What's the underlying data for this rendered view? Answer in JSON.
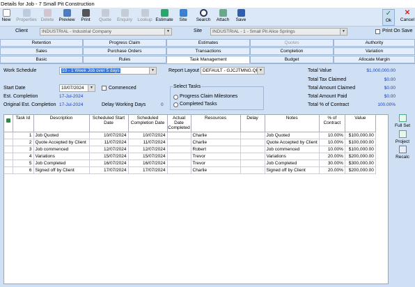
{
  "window": {
    "title": "Details for Job - 7  Small Pit Construction"
  },
  "toolbar": {
    "new": "New",
    "properties": "Properties",
    "delete": "Delete",
    "preview": "Preview",
    "print": "Print",
    "quote": "Quote",
    "enquiry": "Enquiry",
    "lookup": "Lookup",
    "estimate": "Estimate",
    "site": "Site",
    "search": "Search",
    "attach": "Attach",
    "save": "Save",
    "ok": "Ok",
    "cancel": "Cancel"
  },
  "client": {
    "label": "Client",
    "value": "INDUSTRIAL - Industrial Company"
  },
  "site": {
    "label": "Site",
    "value": "INDUSTRIAL - 1 - Small Pit Alice Springs"
  },
  "print_on_save": "Print On Save",
  "tabs": {
    "row1": [
      "Retention",
      "Progress Claim",
      "Estimates",
      "Quotes",
      "Authority"
    ],
    "row2": [
      "Sales",
      "Purchase Orders",
      "Transactions",
      "Completion",
      "Variation"
    ],
    "row3": [
      "Basic",
      "Rules",
      "Task Management",
      "Budget",
      "Allocate Margin"
    ]
  },
  "work_schedule": {
    "label": "Work Schedule",
    "value": "10 - 1 Week Job over 5 days"
  },
  "report_layout": {
    "label": "Report Layout",
    "value": "DEFAULT - GJCJTMNG.QR"
  },
  "start_date": {
    "label": "Start Date",
    "value": "10/07/2024"
  },
  "commenced": "Commenced",
  "est_completion": {
    "label": "Est. Completion",
    "value": "17-Jul-2024"
  },
  "orig_est_completion": {
    "label": "Original Est. Completion",
    "value": "17-Jul-2024"
  },
  "delay_working_days": {
    "label": "Delay Working Days",
    "value": "0"
  },
  "select_tasks": {
    "label": "Select Tasks",
    "opt1": "Progress Claim Milestones",
    "opt2": "Completed Tasks"
  },
  "totals": {
    "total_value": {
      "label": "Total Value",
      "value": "$1,000,000.00"
    },
    "total_tax_claimed": {
      "label": "Total Tax Claimed",
      "value": "$0.00"
    },
    "total_amount_claimed": {
      "label": "Total Amount Claimed",
      "value": "$0.00"
    },
    "total_amount_paid": {
      "label": "Total Amount Paid",
      "value": "$0.00"
    },
    "total_pct_contract": {
      "label": "Total % of Contract",
      "value": "100.00%"
    }
  },
  "grid": {
    "headers": [
      "Task Id",
      "Description",
      "Scheduled Start Date",
      "Scheduled Completion Date",
      "Actual Date Completed",
      "Resources",
      "Delay",
      "Notes",
      "% of Contract",
      "Value"
    ],
    "rows": [
      [
        "1",
        "Job Quoted",
        "10/07/2024",
        "10/07/2024",
        "",
        "Charlie",
        "",
        "Job Quoted",
        "10.00%",
        "$100,000.00"
      ],
      [
        "2",
        "Quote Accepted by Client",
        "11/07/2024",
        "11/07/2024",
        "",
        "Charlie",
        "",
        "Quote Accepted by Client",
        "10.00%",
        "$100,000.00"
      ],
      [
        "3",
        "Job commenced",
        "12/07/2024",
        "12/07/2024",
        "",
        "Robert",
        "",
        "Job commenced",
        "10.00%",
        "$100,000.00"
      ],
      [
        "4",
        "Variations",
        "15/07/2024",
        "15/07/2024",
        "",
        "Trevor",
        "",
        "Variations",
        "20.00%",
        "$200,000.00"
      ],
      [
        "5",
        "Job Completed",
        "16/07/2024",
        "16/07/2024",
        "",
        "Trevor",
        "",
        "Job Completed",
        "30.00%",
        "$300,000.00"
      ],
      [
        "6",
        "Signed off by Client",
        "17/07/2024",
        "17/07/2024",
        "",
        "Charlie",
        "",
        "Signed off by Client",
        "20.00%",
        "$200,000.00"
      ]
    ]
  },
  "side_buttons": {
    "full_set": "Full Set",
    "project": "Project",
    "recalc": "Recalc"
  }
}
